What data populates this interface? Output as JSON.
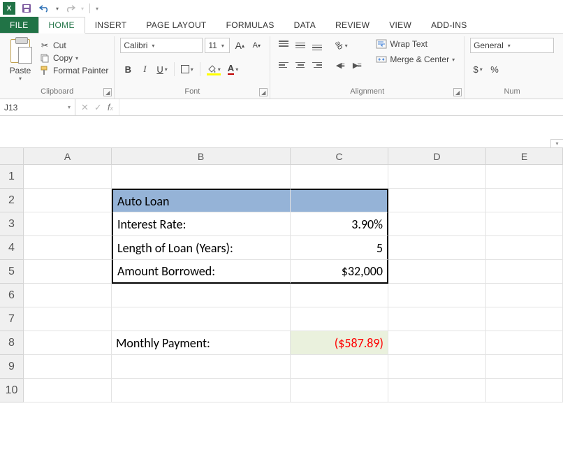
{
  "qat": {
    "save_title": "Save",
    "undo_title": "Undo",
    "redo_title": "Redo"
  },
  "tabs": {
    "file": "FILE",
    "home": "HOME",
    "insert": "INSERT",
    "page_layout": "PAGE LAYOUT",
    "formulas": "FORMULAS",
    "data": "DATA",
    "review": "REVIEW",
    "view": "VIEW",
    "addins": "ADD-INS"
  },
  "ribbon": {
    "clipboard": {
      "paste": "Paste",
      "cut": "Cut",
      "copy": "Copy",
      "format_painter": "Format Painter",
      "label": "Clipboard"
    },
    "font": {
      "name": "Calibri",
      "size": "11",
      "label": "Font",
      "bold": "B",
      "italic": "I",
      "underline": "U"
    },
    "alignment": {
      "wrap": "Wrap Text",
      "merge": "Merge & Center",
      "label": "Alignment"
    },
    "number": {
      "format": "General",
      "label": "Num"
    }
  },
  "formula_bar": {
    "cell_ref": "J13",
    "formula": ""
  },
  "columns": [
    "A",
    "B",
    "C",
    "D",
    "E"
  ],
  "rows": [
    "1",
    "2",
    "3",
    "4",
    "5",
    "6",
    "7",
    "8",
    "9",
    "10"
  ],
  "sheet": {
    "b2": "Auto Loan",
    "b3": "Interest Rate:",
    "c3": "3.90%",
    "b4": "Length of Loan (Years):",
    "c4": "5",
    "b5": "Amount Borrowed:",
    "c5": "$32,000",
    "b8": "Monthly Payment:",
    "c8": "($587.89)"
  },
  "chart_data": {
    "type": "table",
    "title": "Auto Loan",
    "rows": [
      {
        "label": "Interest Rate:",
        "value": 0.039,
        "display": "3.90%"
      },
      {
        "label": "Length of Loan (Years):",
        "value": 5,
        "display": "5"
      },
      {
        "label": "Amount Borrowed:",
        "value": 32000,
        "display": "$32,000"
      },
      {
        "label": "Monthly Payment:",
        "value": -587.89,
        "display": "($587.89)"
      }
    ]
  }
}
